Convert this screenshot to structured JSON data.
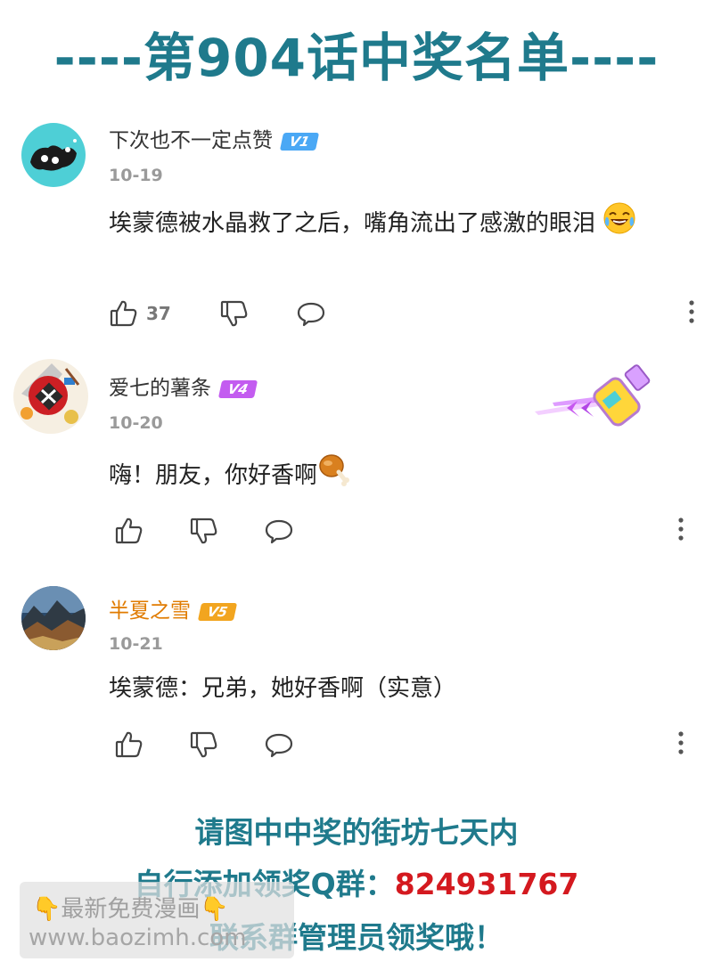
{
  "header": {
    "title": "----第904话中奖名单----"
  },
  "comments": [
    {
      "username": "下次也不一定点赞",
      "level": "V1",
      "level_color": "#4aa8f5",
      "username_color": "#333333",
      "date": "10-19",
      "text": "埃蒙德被水晶救了之后，嘴角流出了感激的眼泪",
      "emoji": "laughing-tears-emoji",
      "like_count": "37"
    },
    {
      "username": "爱七的薯条",
      "level": "V4",
      "level_color": "#c35cf0",
      "username_color": "#333333",
      "date": "10-20",
      "text": "嗨！朋友，你好香啊",
      "emoji": "chicken-leg-emoji",
      "like_count": ""
    },
    {
      "username": "半夏之雪",
      "level": "V5",
      "level_color": "#f2a51f",
      "username_color": "#e07b00",
      "date": "10-21",
      "text": "埃蒙德：兄弟，她好香啊（实意）",
      "like_count": ""
    }
  ],
  "footer": {
    "line1": "请图中中奖的街坊七天内",
    "line2_prefix": "自行添加领奖Q群：",
    "line2_qq": "824931767",
    "line3": "联系群管理员领奖哦！"
  },
  "watermark": {
    "line1": "👇最新免费漫画👇",
    "line2": "www.baozimh.com"
  },
  "colors": {
    "title": "#1f7a8c",
    "qq_number": "#d4191f"
  }
}
